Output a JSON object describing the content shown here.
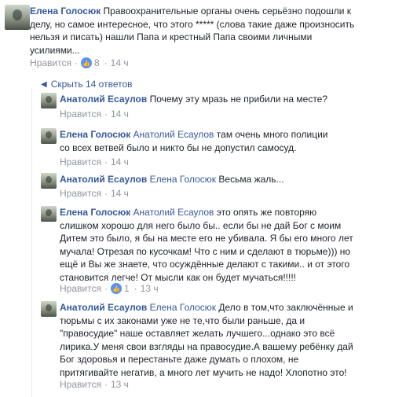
{
  "main_comment": {
    "author": "Елена Голосюк",
    "text": "Правоохранительные органы очень серьёзно подошли к делу, но самое интересное, что этого ***** (слова такие даже произносить нельзя и писать) нашли Папа и крестный Папа своими личными усилиями...",
    "like_label": "Нравится",
    "like_count": "8",
    "time": "14 ч"
  },
  "replies_toggle": "Скрыть 14 ответов",
  "replies": [
    {
      "author": "Анатолий Есаулов",
      "tag": "",
      "text": "Почему эту мразь не прибили на месте?",
      "like_label": "Нравится",
      "like_count": "",
      "time": "14 ч"
    },
    {
      "author": "Елена Голосюк",
      "tag": "Анатолий Есаулов",
      "text": "там очень много полиции со всех ветвей было и никто бы не допустил самосуд.",
      "like_label": "Нравится",
      "like_count": "",
      "time": "14 ч"
    },
    {
      "author": "Анатолий Есаулов",
      "tag": "Елена Голосюк",
      "text": "Весьма жаль...",
      "like_label": "Нравится",
      "like_count": "",
      "time": "14 ч"
    },
    {
      "author": "Елена Голосюк",
      "tag": "Анатолий Есаулов",
      "text": "это опять же повторяю слишком хорошо для него было бы.. если бы не дай Бог с моим Дитем это было, я бы на месте его не убивала. Я бы его много лет мучала! Отрезая по кусочкам! Что с ним и сделают в тюрьме))) но ещё и Вы же знаете, что осуждённые делают с такими.. и от этого становится легче! От мысли как он будет мучаться!!!!!",
      "like_label": "Нравится",
      "like_count": "1",
      "time": "13 ч"
    },
    {
      "author": "Анатолий Есаулов",
      "tag": "Елена Голосюк",
      "text": "Дело в том,что заключённые и тюрьмы с их законами уже не те,что были раньше, да и \"правосудие\" наше оставляет желать лучшего...однако это всё лирика.У меня свои взгляды на правосудие.А вашему ребёнку дай Бог здоровья и перестаньте даже думать о плохом, не притягивайте негатив, а много лет мучить не надо! Хлопотно это!",
      "like_label": "Нравится",
      "like_count": "",
      "time": "13 ч"
    }
  ]
}
